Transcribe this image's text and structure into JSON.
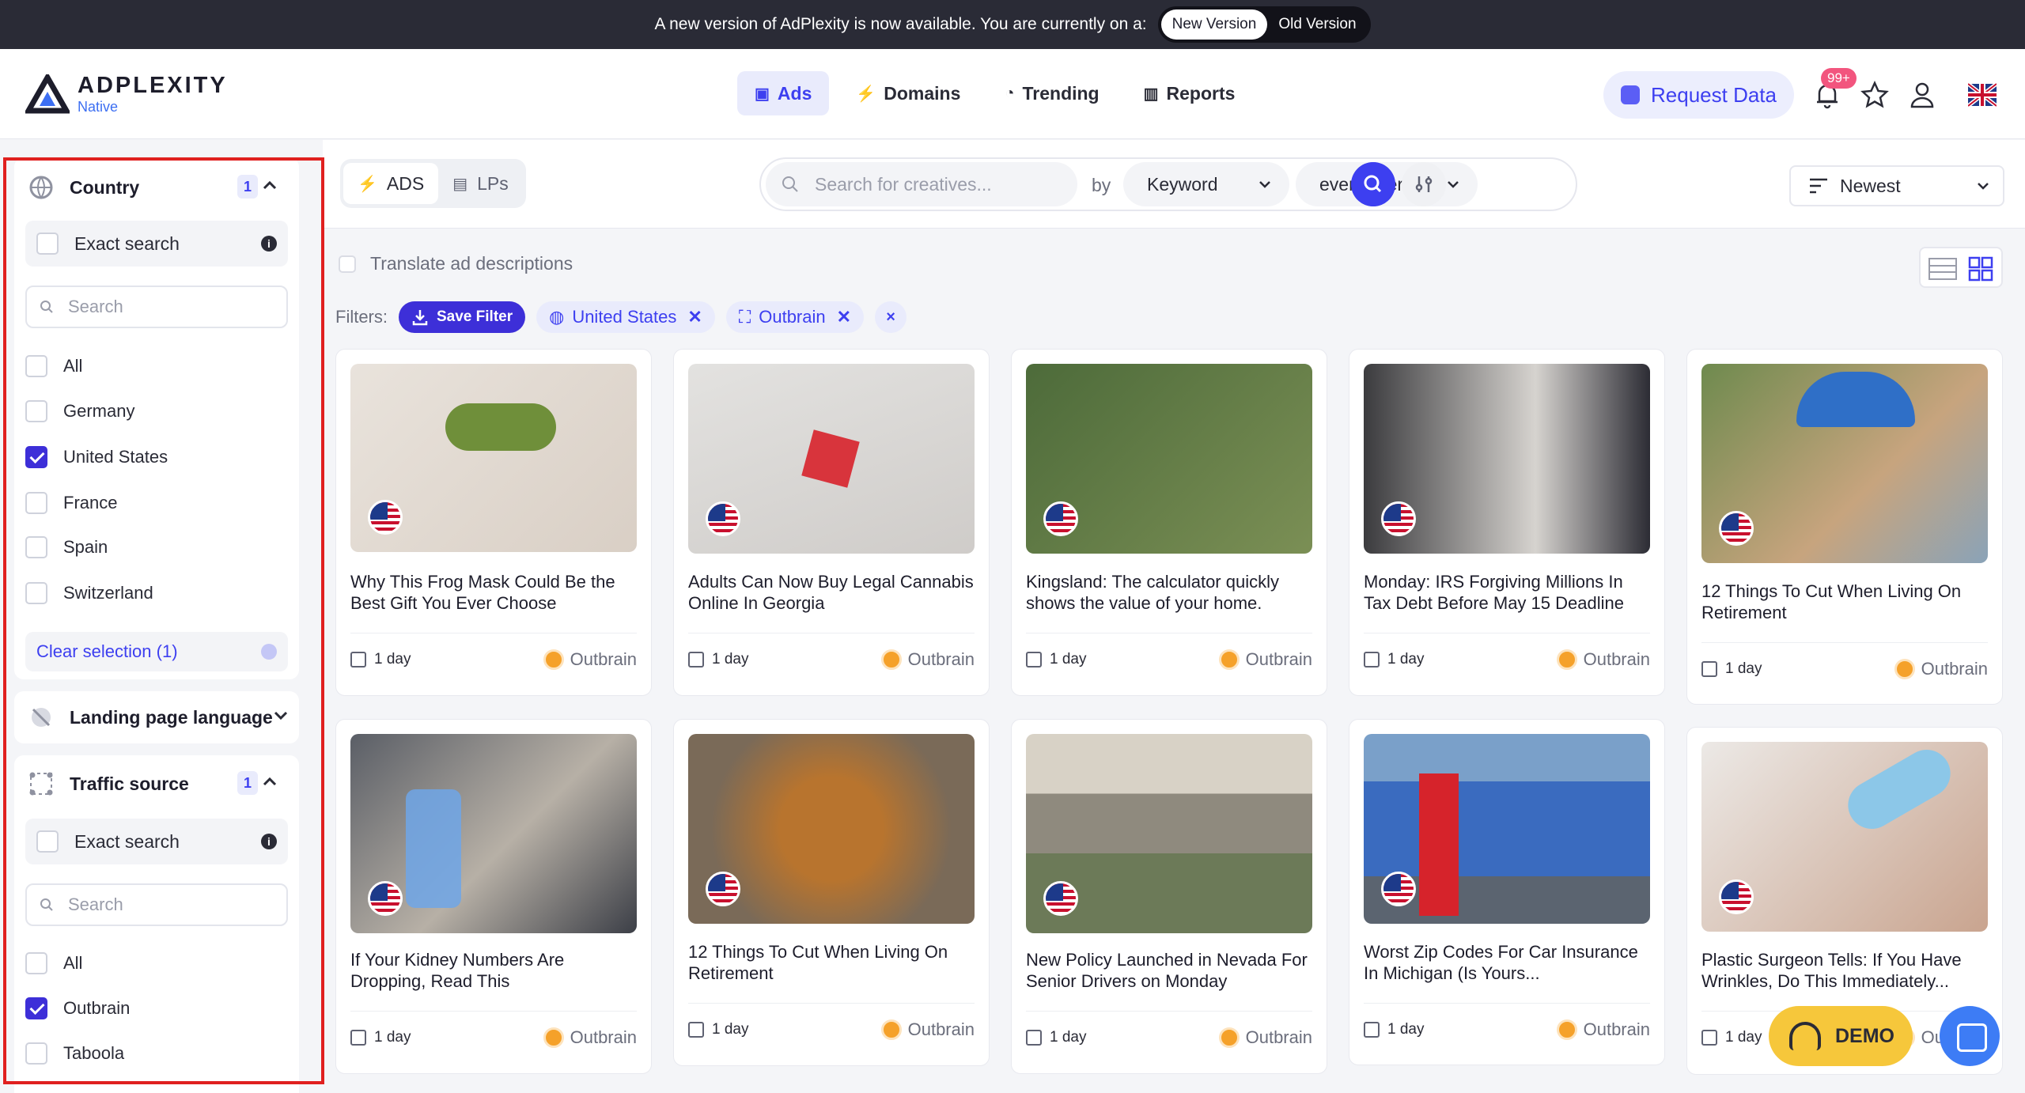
{
  "banner": {
    "message": "A new version of AdPlexity is now available. You are currently on a:",
    "new_version": "New Version",
    "old_version": "Old Version"
  },
  "logo": {
    "brand": "ADPLEXITY",
    "sub": "Native"
  },
  "nav": [
    {
      "label": "Ads",
      "icon": "ads-icon"
    },
    {
      "label": "Domains",
      "icon": "bolt-icon"
    },
    {
      "label": "Trending",
      "icon": "fire-icon"
    },
    {
      "label": "Reports",
      "icon": "reports-icon"
    }
  ],
  "header": {
    "request_data": "Request Data",
    "notifications_badge": "99+"
  },
  "sidebar": {
    "country": {
      "title": "Country",
      "count": "1",
      "exact_search": "Exact search",
      "search_placeholder": "Search",
      "options": [
        {
          "label": "All",
          "checked": false
        },
        {
          "label": "Germany",
          "checked": false
        },
        {
          "label": "United States",
          "checked": true
        },
        {
          "label": "France",
          "checked": false
        },
        {
          "label": "Spain",
          "checked": false
        },
        {
          "label": "Switzerland",
          "checked": false
        }
      ],
      "clear": "Clear selection (1)"
    },
    "landing_language": {
      "title": "Landing page language"
    },
    "traffic_source": {
      "title": "Traffic source",
      "count": "1",
      "exact_search": "Exact search",
      "search_placeholder": "Search",
      "options": [
        {
          "label": "All",
          "checked": false
        },
        {
          "label": "Outbrain",
          "checked": true
        },
        {
          "label": "Taboola",
          "checked": false
        }
      ]
    }
  },
  "toolbar": {
    "tab_ads": "ADS",
    "tab_lps": "LPs",
    "search_placeholder": "Search for creatives...",
    "by": "by",
    "keyword": "Keyword",
    "scope": "everywhere",
    "sort": "Newest"
  },
  "translate_label": "Translate ad descriptions",
  "filters": {
    "label": "Filters:",
    "save": "Save Filter",
    "chips": [
      "United States",
      "Outbrain"
    ],
    "clear": "×"
  },
  "cards": [
    {
      "title": "Why This Frog Mask Could Be the Best Gift You Ever Choose",
      "age": "1 day",
      "source": "Outbrain"
    },
    {
      "title": "Adults Can Now Buy Legal Cannabis Online In Georgia",
      "age": "1 day",
      "source": "Outbrain"
    },
    {
      "title": "Kingsland: The calculator quickly shows the value of your home.",
      "age": "1 day",
      "source": "Outbrain"
    },
    {
      "title": "Monday: IRS Forgiving Millions In Tax Debt Before May 15 Deadline",
      "age": "1 day",
      "source": "Outbrain"
    },
    {
      "title": "12 Things To Cut When Living On Retirement",
      "age": "1 day",
      "source": "Outbrain"
    },
    {
      "title": "If Your Kidney Numbers Are Dropping, Read This",
      "age": "1 day",
      "source": "Outbrain"
    },
    {
      "title": "12 Things To Cut When Living On Retirement",
      "age": "1 day",
      "source": "Outbrain"
    },
    {
      "title": "New Policy Launched in Nevada For Senior Drivers on Monday",
      "age": "1 day",
      "source": "Outbrain"
    },
    {
      "title": "Worst Zip Codes For Car Insurance In Michigan (Is Yours...",
      "age": "1 day",
      "source": "Outbrain"
    },
    {
      "title": "Plastic Surgeon Tells: If You Have Wrinkles, Do This Immediately...",
      "age": "1 day",
      "source": "Outbrain"
    }
  ],
  "demo": "DEMO"
}
